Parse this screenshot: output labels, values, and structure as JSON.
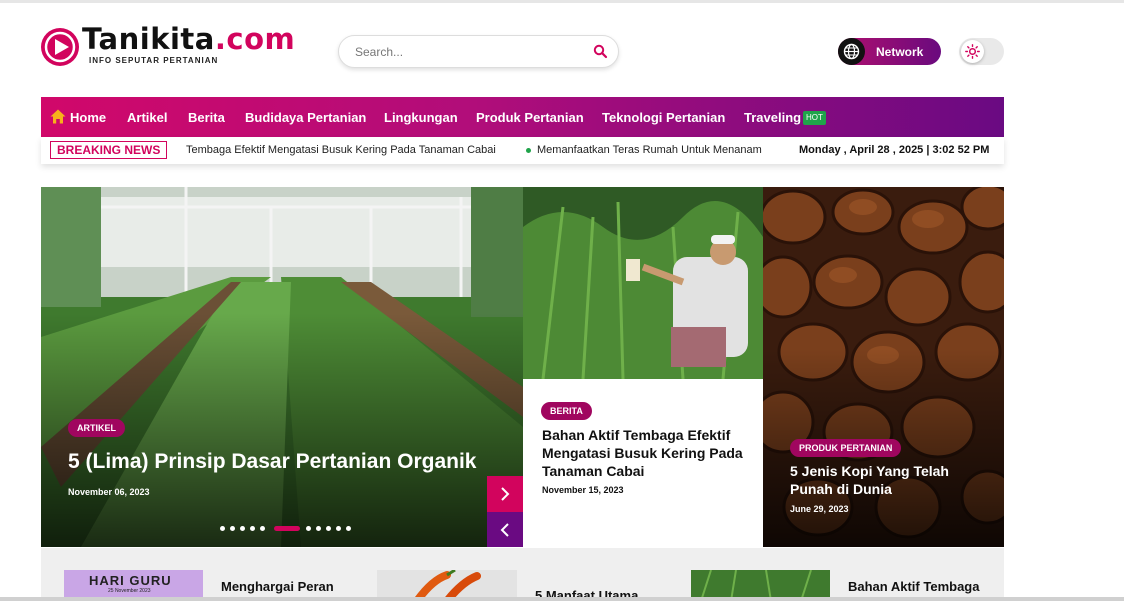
{
  "header": {
    "logo_name": "Tanikita",
    "logo_tld": ".com",
    "tagline": "INFO SEPUTAR PERTANIAN",
    "search_placeholder": "Search...",
    "network_label": "Network",
    "icons": [
      "play-logo-icon",
      "search-icon",
      "globe-icon",
      "sun-icon"
    ]
  },
  "nav": {
    "items": [
      "Home",
      "Artikel",
      "Berita",
      "Budidaya Pertanian",
      "Lingkungan",
      "Produk Pertanian",
      "Teknologi Pertanian",
      "Traveling"
    ],
    "hot_badge": "HOT",
    "icons": [
      "home-icon"
    ]
  },
  "breaking": {
    "label": "BREAKING NEWS",
    "items": [
      "Tembaga Efektif Mengatasi Busuk Kering Pada Tanaman Cabai",
      "Memanfaatkan Teras Rumah Untuk Menanam"
    ],
    "date": "Monday , April 28 , 2025",
    "time": "3:02 52 PM"
  },
  "hero": {
    "main": {
      "category": "ARTIKEL",
      "title": "5 (Lima) Prinsip Dasar Pertanian Organik",
      "date": "November 06, 2023"
    },
    "second": {
      "category": "BERITA",
      "title": "Bahan Aktif Tembaga Efektif Mengatasi Busuk Kering Pada Tanaman Cabai",
      "date": "November 15, 2023"
    },
    "third": {
      "category": "PRODUK PERTANIAN",
      "title": "5 Jenis Kopi Yang Telah Punah di Dunia",
      "date": "June 29, 2023"
    },
    "slide_count": 11,
    "active_slide": 6
  },
  "bottom": {
    "thumb1_text": "HARI GURU",
    "thumb1_sub": "25 November 2023",
    "items": [
      "Menghargai Peran",
      "5 Manfaat Utama",
      "Bahan Aktif Tembaga"
    ]
  },
  "colors": {
    "brand": "#d2045d",
    "purple": "#6a0a82",
    "hot": "#1fa34a"
  }
}
